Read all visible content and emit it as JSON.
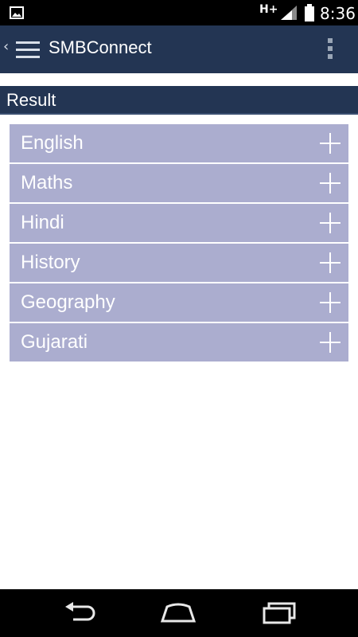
{
  "status_bar": {
    "network_type": "H+",
    "time": "8:36",
    "icons": [
      "gallery-icon",
      "signal-icon",
      "battery-icon"
    ]
  },
  "app_bar": {
    "title": "SMBConnect",
    "icons": [
      "back-caret-icon",
      "menu-icon",
      "overflow-menu-icon"
    ]
  },
  "section": {
    "title": "Result"
  },
  "subjects": [
    {
      "label": "English",
      "icon": "plus-icon"
    },
    {
      "label": "Maths",
      "icon": "plus-icon"
    },
    {
      "label": "Hindi",
      "icon": "plus-icon"
    },
    {
      "label": "History",
      "icon": "plus-icon"
    },
    {
      "label": "Geography",
      "icon": "plus-icon"
    },
    {
      "label": "Gujarati",
      "icon": "plus-icon"
    }
  ],
  "nav_bar": {
    "icons": [
      "back-nav-icon",
      "home-nav-icon",
      "recents-nav-icon"
    ]
  },
  "colors": {
    "app_bar": "#233553",
    "subject_row": "#abadcf",
    "text_on_dark": "#ffffff"
  }
}
